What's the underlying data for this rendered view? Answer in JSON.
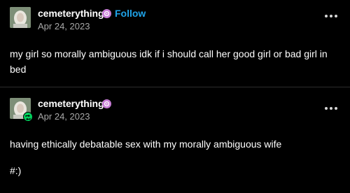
{
  "posts": [
    {
      "username": "cemeterything",
      "follow_label": "Follow",
      "date": "Apr 24, 2023",
      "body": "my girl so morally ambiguous idk if i should call her good girl or bad girl in bed"
    },
    {
      "username": "cemeterything",
      "date": "Apr 24, 2023",
      "body": "having ethically debatable sex with my morally ambiguous wife",
      "tags": "#:)"
    }
  ],
  "colors": {
    "background": "#000000",
    "follow": "#1fa4ea",
    "badge": "#c77dd6",
    "reblog": "#01cf5c",
    "date": "#a8a8a8"
  },
  "icons": [
    "avatar",
    "verified-badge-icon",
    "more-options-icon",
    "reblog-icon"
  ]
}
